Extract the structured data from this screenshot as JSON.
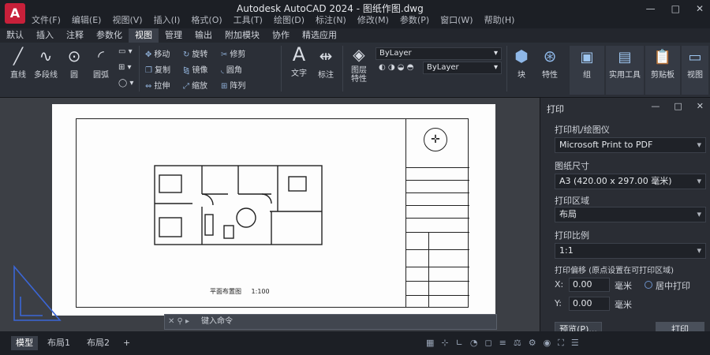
{
  "app": {
    "logo": "A",
    "window_title": "Autodesk AutoCAD 2024 - 图纸作图.dwg",
    "menu": [
      "文件(F)",
      "编辑(E)",
      "视图(V)",
      "插入(I)",
      "格式(O)",
      "工具(T)",
      "绘图(D)",
      "标注(N)",
      "修改(M)",
      "参数(P)",
      "窗口(W)",
      "帮助(H)"
    ],
    "window_controls": [
      "—",
      "□",
      "✕"
    ]
  },
  "ribbon_tabs": [
    "默认",
    "插入",
    "注释",
    "参数化",
    "视图",
    "管理",
    "输出",
    "附加模块",
    "协作",
    "精选应用"
  ],
  "active_tab": "视图",
  "ribbon": {
    "line": "直线",
    "polyline": "多段线",
    "circle": "圆",
    "arc": "圆弧",
    "move": "移动",
    "rotate": "旋转",
    "trim": "修剪",
    "copy": "复制",
    "mirror": "镜像",
    "fillet": "圆角",
    "stretch": "拉伸",
    "scale": "缩放",
    "array": "阵列",
    "text": "文字",
    "dimension": "标注",
    "layer_props": "图层\n特性",
    "layer_value": "ByLayer",
    "color_value": "ByLayer",
    "block": "块",
    "properties": "特性",
    "group": "组",
    "utilities": "实用工具",
    "clipboard": "剪贴板",
    "view": "视图"
  },
  "drawing": {
    "plan_title": "平面布置图",
    "plan_scale": "1:100"
  },
  "command_line": {
    "placeholder": "键入命令"
  },
  "print_panel": {
    "title": "打印",
    "printer_label": "打印机/绘图仪",
    "printer_value": "Microsoft Print to PDF",
    "paper_label": "图纸尺寸",
    "paper_value": "A3 (420.00 x 297.00 毫米)",
    "area_label": "打印区域",
    "area_value": "布局",
    "scale_label": "打印比例",
    "scale_value": "1:1",
    "offset_label": "打印偏移 (原点设置在可打印区域)",
    "x_label": "X:",
    "x_value": "0.00",
    "y_label": "Y:",
    "y_value": "0.00",
    "unit": "毫米",
    "center_label": "居中打印",
    "preview_button": "预览(P)...",
    "print_button": "打印"
  },
  "status": {
    "tabs": [
      "模型",
      "布局1",
      "布局2"
    ],
    "active": "模型",
    "add_tab": "+"
  }
}
